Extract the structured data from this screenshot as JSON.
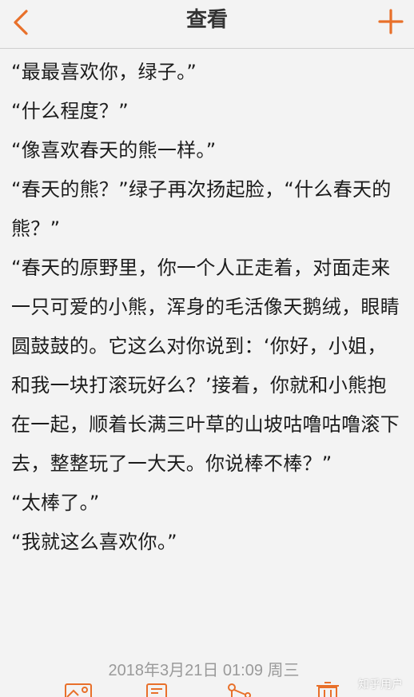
{
  "header": {
    "title": "查看",
    "back_icon": "chevron-left-icon",
    "add_icon": "plus-icon",
    "accent_color": "#e8702a"
  },
  "content": {
    "paragraphs": [
      "“最最喜欢你，绿子。”",
      "“什么程度？”",
      "“像喜欢春天的熊一样。”",
      "“春天的熊？”绿子再次扬起脸，“什么春天的熊？”",
      "“春天的原野里，你一个人正走着，对面走来一只可爱的小熊，浑身的毛活像天鹅绒，眼睛圆鼓鼓的。它这么对你说到：‘你好，小姐，和我一块打滚玩好么？’接着，你就和小熊抱在一起，顺着长满三叶草的山坡咕噜咕噜滚下去，整整玩了一大天。你说棒不棒？”",
      "“太棒了。”",
      "“我就这么喜欢你。”"
    ]
  },
  "footer": {
    "timestamp": "2018年3月21日 01:09 周三",
    "tools": [
      "picture-card-icon",
      "edit-document-icon",
      "share-nodes-icon",
      "trash-icon"
    ]
  },
  "watermark": "知乎用户"
}
